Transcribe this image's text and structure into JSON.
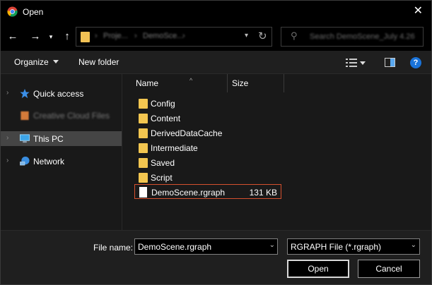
{
  "window": {
    "title": "Open"
  },
  "nav": {
    "breadcrumbs": [
      "Proje...",
      "DemoSce..."
    ],
    "search_placeholder": "Search DemoScene_July 4.26"
  },
  "toolbar": {
    "organize": "Organize",
    "new_folder": "New folder"
  },
  "sidebar": {
    "items": [
      {
        "label": "Quick access",
        "icon": "star-icon"
      },
      {
        "label": "Creative Cloud Files",
        "icon": "creative-cloud-icon"
      },
      {
        "label": "This PC",
        "icon": "computer-icon",
        "selected": true
      },
      {
        "label": "Network",
        "icon": "network-icon"
      }
    ]
  },
  "columns": {
    "name": "Name",
    "size": "Size"
  },
  "files": [
    {
      "name": "Config",
      "type": "folder"
    },
    {
      "name": "Content",
      "type": "folder"
    },
    {
      "name": "DerivedDataCache",
      "type": "folder"
    },
    {
      "name": "Intermediate",
      "type": "folder"
    },
    {
      "name": "Saved",
      "type": "folder"
    },
    {
      "name": "Script",
      "type": "folder"
    },
    {
      "name": "DemoScene.rgraph",
      "type": "file",
      "size": "131 KB",
      "selected": true
    }
  ],
  "footer": {
    "file_name_label": "File name:",
    "file_name_value": "DemoScene.rgraph",
    "file_type": "RGRAPH File (*.rgraph)",
    "open_button": "Open",
    "cancel_button": "Cancel"
  },
  "colors": {
    "selection_border": "#d5502e",
    "folder": "#f3c650",
    "help": "#1a73d9"
  }
}
